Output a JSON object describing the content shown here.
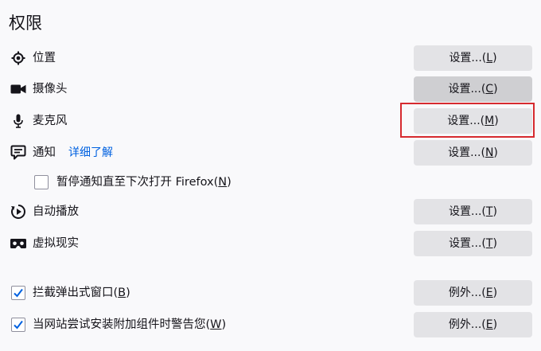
{
  "section_title": "权限",
  "permissions": {
    "location": {
      "icon": "location-crosshair-icon",
      "label": "位置",
      "button_text": "设置...",
      "button_key": "L"
    },
    "camera": {
      "icon": "camera-icon",
      "label": "摄像头",
      "button_text": "设置...",
      "button_key": "C"
    },
    "microphone": {
      "icon": "microphone-icon",
      "label": "麦克风",
      "button_text": "设置...",
      "button_key": "M"
    },
    "notifications": {
      "icon": "notification-speech-bubble-icon",
      "label": "通知",
      "learn_more": "详细了解",
      "button_text": "设置...",
      "button_key": "N"
    },
    "pause_notifications": {
      "label_main": "暂停通知直至下次打开 Firefox",
      "label_key": "N",
      "checked": false
    },
    "autoplay": {
      "icon": "autoplay-icon",
      "label": "自动播放",
      "button_text": "设置...",
      "button_key": "T"
    },
    "virtual_reality": {
      "icon": "vr-headset-icon",
      "label": "虚拟现实",
      "button_text": "设置...",
      "button_key": "T"
    }
  },
  "block_popups": {
    "label_main": "拦截弹出式窗口",
    "label_key": "B",
    "checked": true,
    "button_text": "例外...",
    "button_key": "E"
  },
  "warn_addons": {
    "label_main": "当网站尝试安装附加组件时警告您",
    "label_key": "W",
    "checked": true,
    "button_text": "例外...",
    "button_key": "E"
  },
  "colors": {
    "accent_link": "#0061e0",
    "checkbox_check": "#0061e0",
    "highlight_border": "#d62a2f",
    "button_bg": "#e3e3e6",
    "button_hover_bg": "#cfcfd2"
  }
}
